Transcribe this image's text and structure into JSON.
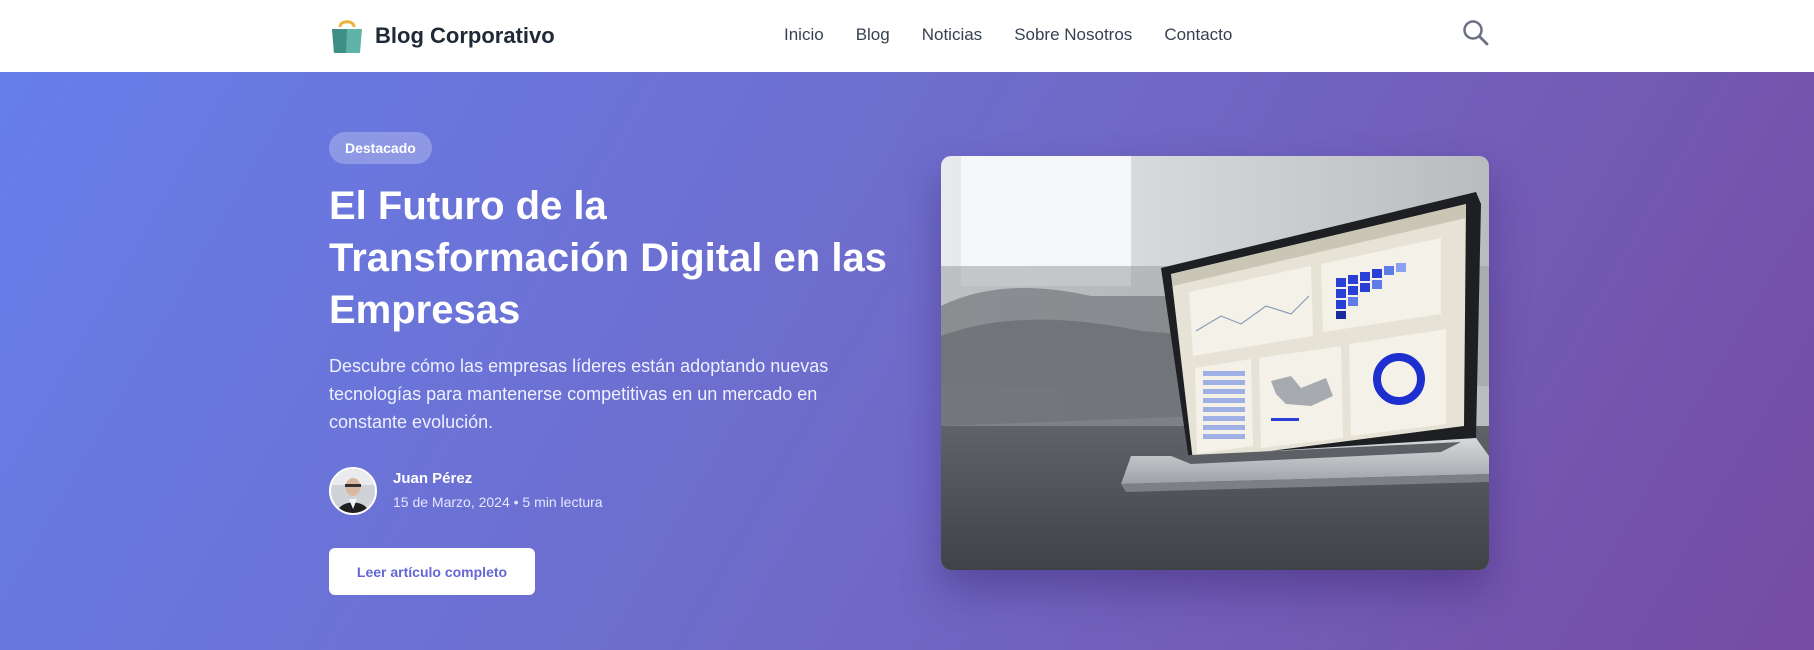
{
  "header": {
    "brand": "Blog Corporativo",
    "nav": [
      "Inicio",
      "Blog",
      "Noticias",
      "Sobre Nosotros",
      "Contacto"
    ],
    "search_icon": "search-icon",
    "logo_icon": "shopping-bag-icon"
  },
  "hero": {
    "badge": "Destacado",
    "title": "El Futuro de la Transformación Digital en las Empresas",
    "subtitle": "Descubre cómo las empresas líderes están adoptando nuevas tecnologías para mantenerse competitivas en un mercado en constante evolución.",
    "author": {
      "name": "Juan Pérez",
      "meta": "15 de Marzo, 2024 • 5 min lectura"
    },
    "cta": "Leer artículo completo"
  },
  "colors": {
    "gradient_start": "#667eea",
    "gradient_end": "#764ba2",
    "cta_text": "#6466d8"
  }
}
